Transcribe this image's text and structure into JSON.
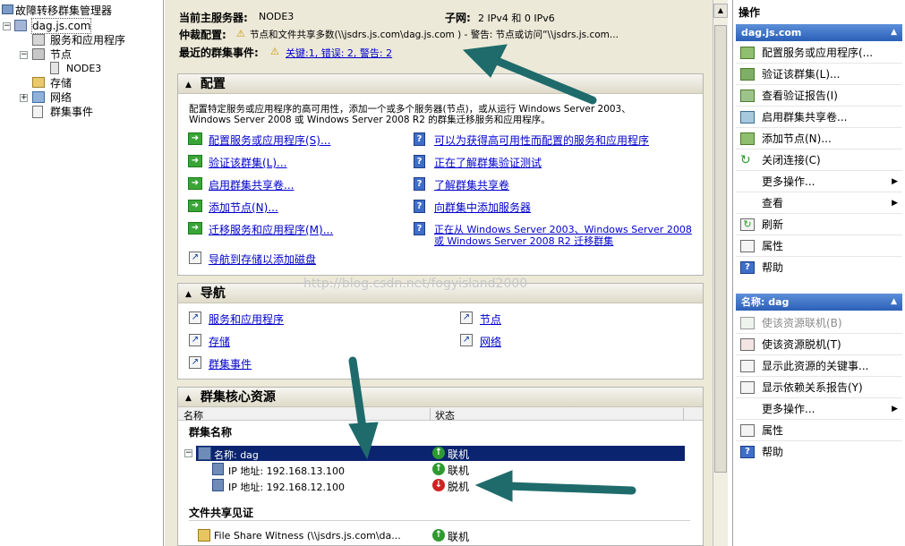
{
  "tree": {
    "root": "故障转移群集管理器",
    "cluster": "dag.js.com",
    "services": "服务和应用程序",
    "nodes": "节点",
    "node3": "NODE3",
    "storage": "存储",
    "network": "网络",
    "events": "群集事件"
  },
  "summary": {
    "server_label": "当前主服务器:",
    "server_value": "NODE3",
    "subnet_label": "子网:",
    "subnet_value": "2 IPv4 和 0 IPv6",
    "quorum_label": "仲裁配置:",
    "quorum_value": "节点和文件共享多数(\\\\jsdrs.js.com\\dag.js.com ) - 警告: 节点或访问“\\\\jsdrs.js.com...",
    "events_label": "最近的群集事件:",
    "events_value": "关键:1, 错误: 2, 警告: 2"
  },
  "config": {
    "title": "配置",
    "desc_line1": "配置特定服务或应用程序的高可用性，添加一个或多个服务器(节点)，或从运行 Windows Server 2003、",
    "desc_line2": "Windows Server 2008 或 Windows Server 2008 R2 的群集迁移服务和应用程序。",
    "left_links": [
      "配置服务或应用程序(S)...",
      "验证该群集(L)...",
      "启用群集共享卷...",
      "添加节点(N)...",
      "迁移服务和应用程序(M)...",
      "导航到存储以添加磁盘"
    ],
    "right_links": [
      "可以为获得高可用性而配置的服务和应用程序",
      "正在了解群集验证测试",
      "了解群集共享卷",
      "向群集中添加服务器"
    ],
    "right_link5_line1": "正在从 Windows Server 2003、Windows Server 2008",
    "right_link5_line2": "或 Windows Server 2008 R2 迁移群集"
  },
  "navigate": {
    "title": "导航",
    "links": [
      "服务和应用程序",
      "存储",
      "群集事件",
      "节点",
      "网络"
    ]
  },
  "core": {
    "title": "群集核心资源",
    "col_name": "名称",
    "col_status": "状态",
    "group_cluster": "群集名称",
    "row_name": "名称: dag",
    "row_name_status": "联机",
    "ip1": "IP 地址: 192.168.13.100",
    "ip1_status": "联机",
    "ip2": "IP 地址: 192.168.12.100",
    "ip2_status": "脱机",
    "group_witness": "文件共享见证",
    "witness": "File Share Witness (\\\\jsdrs.js.com\\da...",
    "witness_status": "联机"
  },
  "watermark": "http://blog.csdn.net/fogyisland2000",
  "actions": {
    "title": "操作",
    "section1": "dag.js.com",
    "items1": [
      "配置服务或应用程序(...",
      "验证该群集(L)...",
      "查看验证报告(I)",
      "启用群集共享卷...",
      "添加节点(N)...",
      "关闭连接(C)",
      "更多操作...",
      "查看",
      "刷新",
      "属性",
      "帮助"
    ],
    "section2": "名称: dag",
    "items2": [
      "使该资源联机(B)",
      "使该资源脱机(T)",
      "显示此资源的关键事...",
      "显示依赖关系报告(Y)",
      "更多操作...",
      "属性",
      "帮助"
    ]
  },
  "colors": {
    "arrow": "#1f6b6b",
    "section_blue": "#2a5fb8",
    "link": "#0000cc"
  }
}
